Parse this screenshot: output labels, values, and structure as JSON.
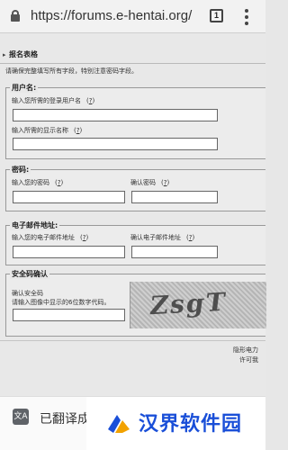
{
  "browser": {
    "url": "https://forums.e-hentai.org/ir",
    "tab_count": "1"
  },
  "form": {
    "section_title": "报名表格",
    "warning": "请确保完整填写所有字段，特别注意密码字段。",
    "username": {
      "legend": "用户名:",
      "login_label": "输入您所需的登录用户名",
      "display_label": "输入所需的显示名称",
      "help": "?"
    },
    "password": {
      "legend": "密码:",
      "enter_label": "输入您的密码",
      "confirm_label": "确认密码",
      "help": "?"
    },
    "email": {
      "legend": "电子邮件地址:",
      "enter_label": "输入您的电子邮件地址",
      "confirm_label": "确认电子邮件地址",
      "help": "?"
    },
    "captcha": {
      "legend": "安全码确认",
      "line1": "确认安全码",
      "line2": "请输入图像中显示的6位数字代码。",
      "image_text": "ZsgT"
    },
    "footer_line1": "隐形电力",
    "footer_line2": "许可我"
  },
  "bottom_bar": {
    "translate_text": "已翻译成",
    "translate_icon_glyph": "文A",
    "watermark_text": "汉界软件园"
  }
}
